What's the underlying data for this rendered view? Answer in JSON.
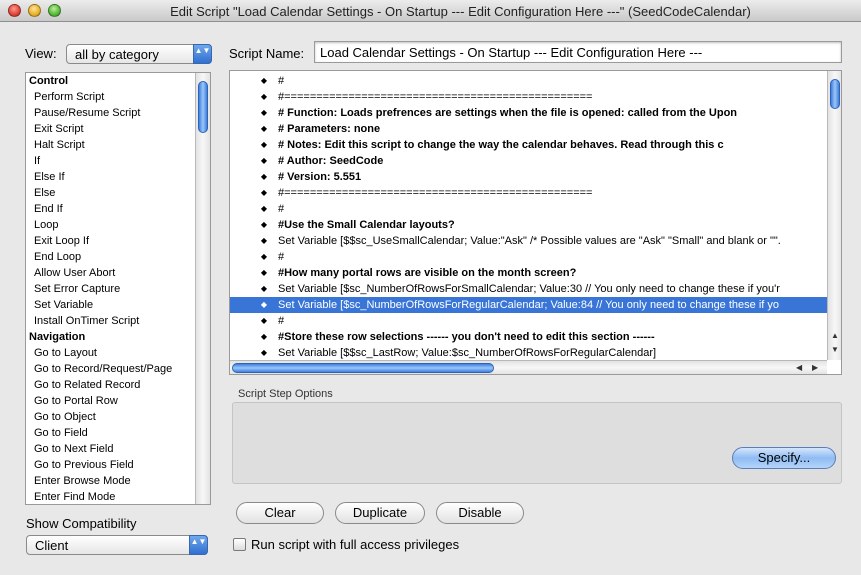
{
  "window": {
    "title": "Edit Script \"Load Calendar Settings - On Startup --- Edit Configuration Here ---\" (SeedCodeCalendar)"
  },
  "view": {
    "label": "View:",
    "selected": "all by category"
  },
  "script_name": {
    "label": "Script Name:",
    "value": "Load Calendar Settings - On Startup --- Edit Configuration Here ---"
  },
  "steps_list": [
    {
      "label": "Control",
      "category": true
    },
    {
      "label": "Perform Script"
    },
    {
      "label": "Pause/Resume Script"
    },
    {
      "label": "Exit Script"
    },
    {
      "label": "Halt Script"
    },
    {
      "label": "If"
    },
    {
      "label": "Else If"
    },
    {
      "label": "Else"
    },
    {
      "label": "End If"
    },
    {
      "label": "Loop"
    },
    {
      "label": "Exit Loop If"
    },
    {
      "label": "End Loop"
    },
    {
      "label": "Allow User Abort"
    },
    {
      "label": "Set Error Capture"
    },
    {
      "label": "Set Variable"
    },
    {
      "label": "Install OnTimer Script"
    },
    {
      "label": "Navigation",
      "category": true
    },
    {
      "label": "Go to Layout"
    },
    {
      "label": "Go to Record/Request/Page"
    },
    {
      "label": "Go to Related Record"
    },
    {
      "label": "Go to Portal Row"
    },
    {
      "label": "Go to Object"
    },
    {
      "label": "Go to Field"
    },
    {
      "label": "Go to Next Field"
    },
    {
      "label": "Go to Previous Field"
    },
    {
      "label": "Enter Browse Mode"
    },
    {
      "label": "Enter Find Mode"
    }
  ],
  "compatibility": {
    "label": "Show Compatibility",
    "selected": "Client"
  },
  "script_lines": [
    {
      "text": "#"
    },
    {
      "text": "#================================================"
    },
    {
      "text": "#  Function:          Loads prefrences are settings when the file is opened: called from the Upon",
      "bold": true
    },
    {
      "text": "#  Parameters:       none",
      "bold": true
    },
    {
      "text": "#  Notes:               Edit this script to change the way the calendar behaves. Read through this c",
      "bold": true
    },
    {
      "text": "#  Author:              SeedCode",
      "bold": true
    },
    {
      "text": "#  Version:             5.551",
      "bold": true
    },
    {
      "text": "#================================================"
    },
    {
      "text": "#"
    },
    {
      "text": "#Use the Small Calendar layouts?",
      "bold": true
    },
    {
      "text": "Set Variable [$$sc_UseSmallCalendar; Value:\"Ask\"  /*  Possible values are \"Ask\" \"Small\" and blank or \"\"."
    },
    {
      "text": "#"
    },
    {
      "text": "#How many portal rows are visible on the month screen?",
      "bold": true
    },
    {
      "text": "Set Variable [$sc_NumberOfRowsForSmallCalendar; Value:30  // You only need to change these if you'r"
    },
    {
      "text": "Set Variable [$sc_NumberOfRowsForRegularCalendar; Value:84  // You only need to change these if yo",
      "selected": true
    },
    {
      "text": "#"
    },
    {
      "text": "#Store these row selections ------ you don't need to edit this section ------",
      "bold": true
    },
    {
      "text": "Set Variable [$$sc_LastRow; Value:$sc_NumberOfRowsForRegularCalendar]"
    }
  ],
  "step_options": {
    "label": "Script Step Options",
    "specify_label": "Specify..."
  },
  "buttons": {
    "clear": "Clear",
    "duplicate": "Duplicate",
    "disable": "Disable"
  },
  "full_access": {
    "label": "Run script with full access privileges",
    "checked": false
  },
  "icons": {
    "line_handle": "◆",
    "popup_arrows": "▲▼",
    "scroll_up": "▲",
    "scroll_down": "▼",
    "scroll_left": "◀",
    "scroll_right": "▶"
  },
  "colors": {
    "selection": "#3875d7",
    "accent": "#2f6fd0"
  }
}
